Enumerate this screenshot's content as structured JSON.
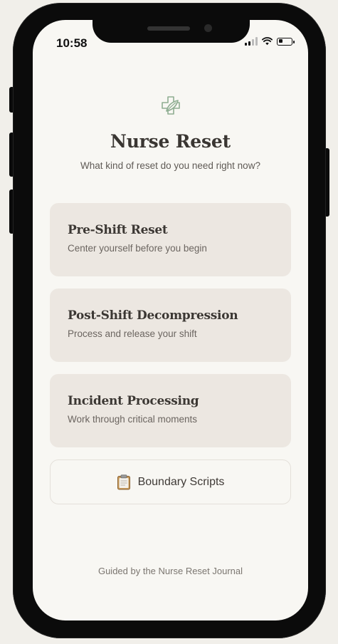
{
  "status_bar": {
    "time": "10:58",
    "battery_level": 0.35
  },
  "app": {
    "title": "Nurse Reset",
    "subtitle": "What kind of reset do you need right now?",
    "logo_icon": "leaf-cross-icon",
    "accent_color": "#8fae92"
  },
  "options": [
    {
      "title": "Pre-Shift Reset",
      "description": "Center yourself before you begin"
    },
    {
      "title": "Post-Shift Decompression",
      "description": "Process and release your shift"
    },
    {
      "title": "Incident Processing",
      "description": "Work through critical moments"
    }
  ],
  "boundary": {
    "label": "Boundary Scripts",
    "icon": "clipboard-icon"
  },
  "footer": {
    "text": "Guided by the Nurse Reset Journal"
  }
}
